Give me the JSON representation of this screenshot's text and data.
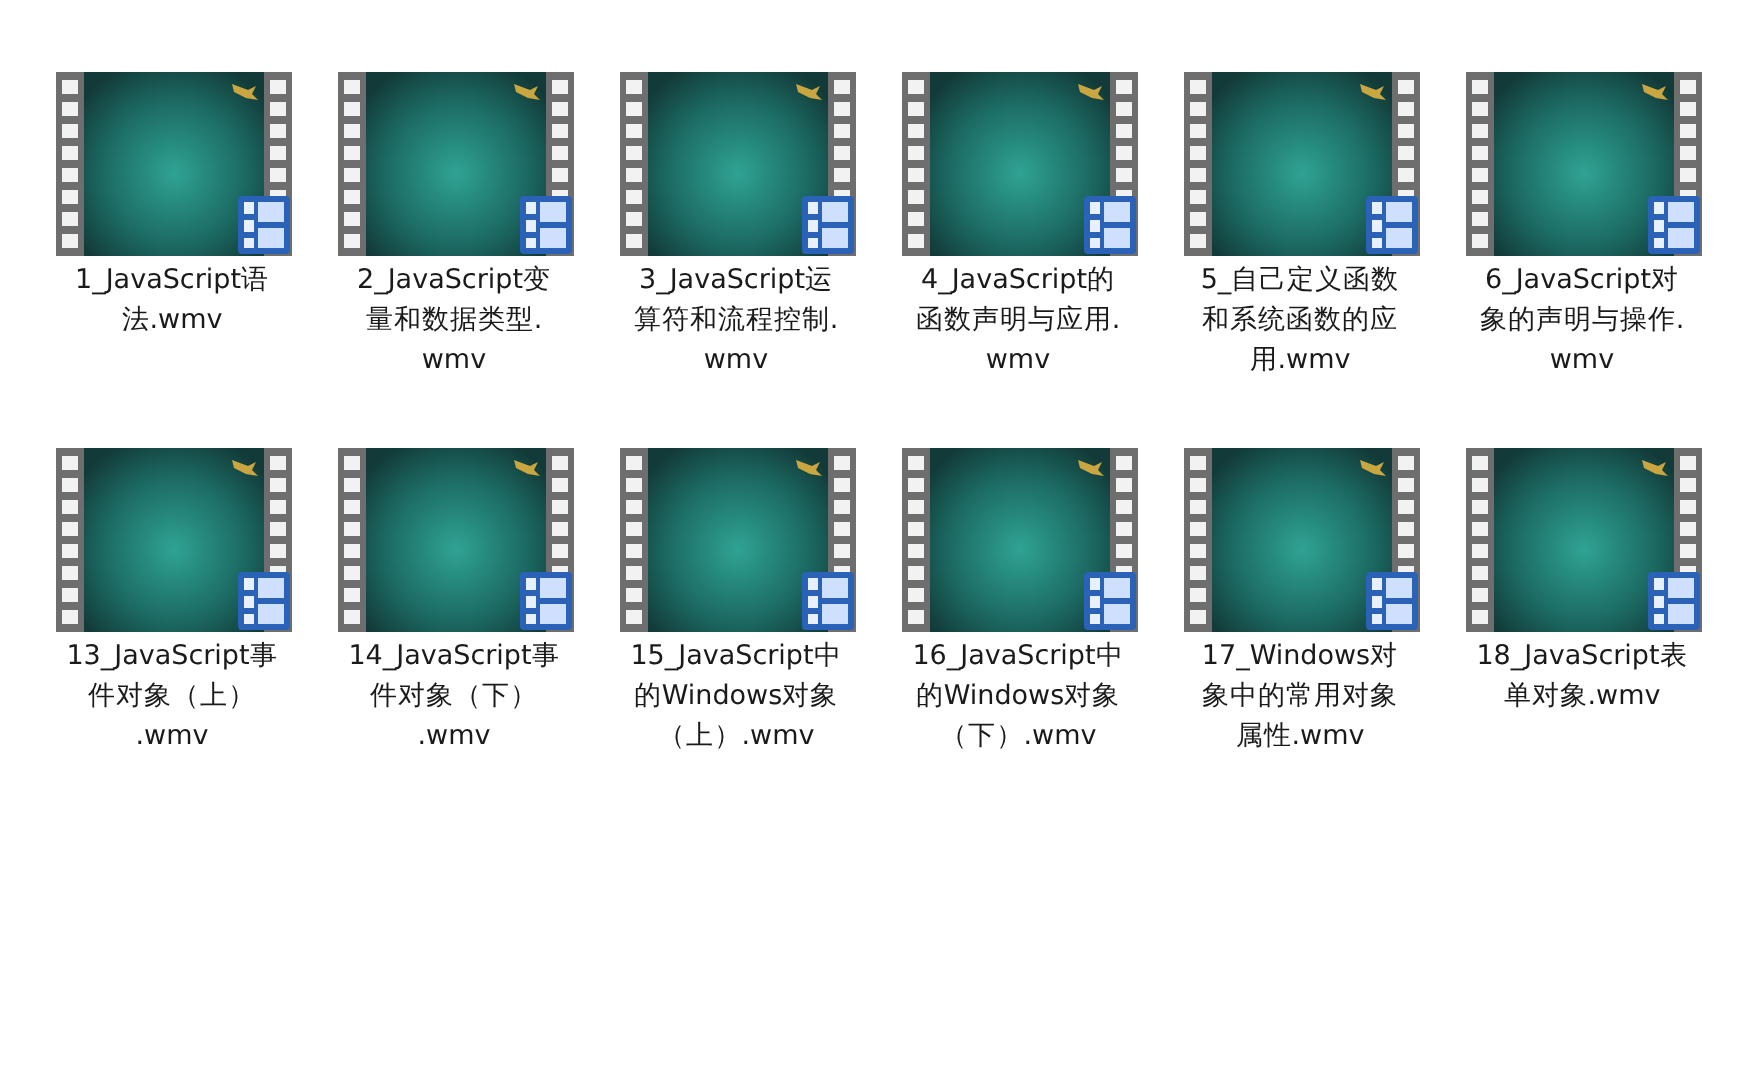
{
  "files": [
    {
      "lines": [
        "1_JavaScript语",
        "法.wmv"
      ]
    },
    {
      "lines": [
        "2_JavaScript变",
        "量和数据类型.",
        "wmv"
      ]
    },
    {
      "lines": [
        "3_JavaScript运",
        "算符和流程控制.",
        "wmv"
      ]
    },
    {
      "lines": [
        "4_JavaScript的",
        "函数声明与应用.",
        "wmv"
      ]
    },
    {
      "lines": [
        "5_自己定义函数",
        "和系统函数的应",
        "用.wmv"
      ]
    },
    {
      "lines": [
        "6_JavaScript对",
        "象的声明与操作.",
        "wmv"
      ]
    },
    {
      "lines": [
        "13_JavaScript事",
        "件对象（上）",
        ".wmv"
      ]
    },
    {
      "lines": [
        "14_JavaScript事",
        "件对象（下）",
        ".wmv"
      ]
    },
    {
      "lines": [
        "15_JavaScript中",
        "的Windows对象",
        "（上）.wmv"
      ]
    },
    {
      "lines": [
        "16_JavaScript中",
        "的Windows对象",
        "（下）.wmv"
      ]
    },
    {
      "lines": [
        "17_Windows对",
        "象中的常用对象",
        "属性.wmv"
      ]
    },
    {
      "lines": [
        "18_JavaScript表",
        "单对象.wmv"
      ]
    }
  ]
}
